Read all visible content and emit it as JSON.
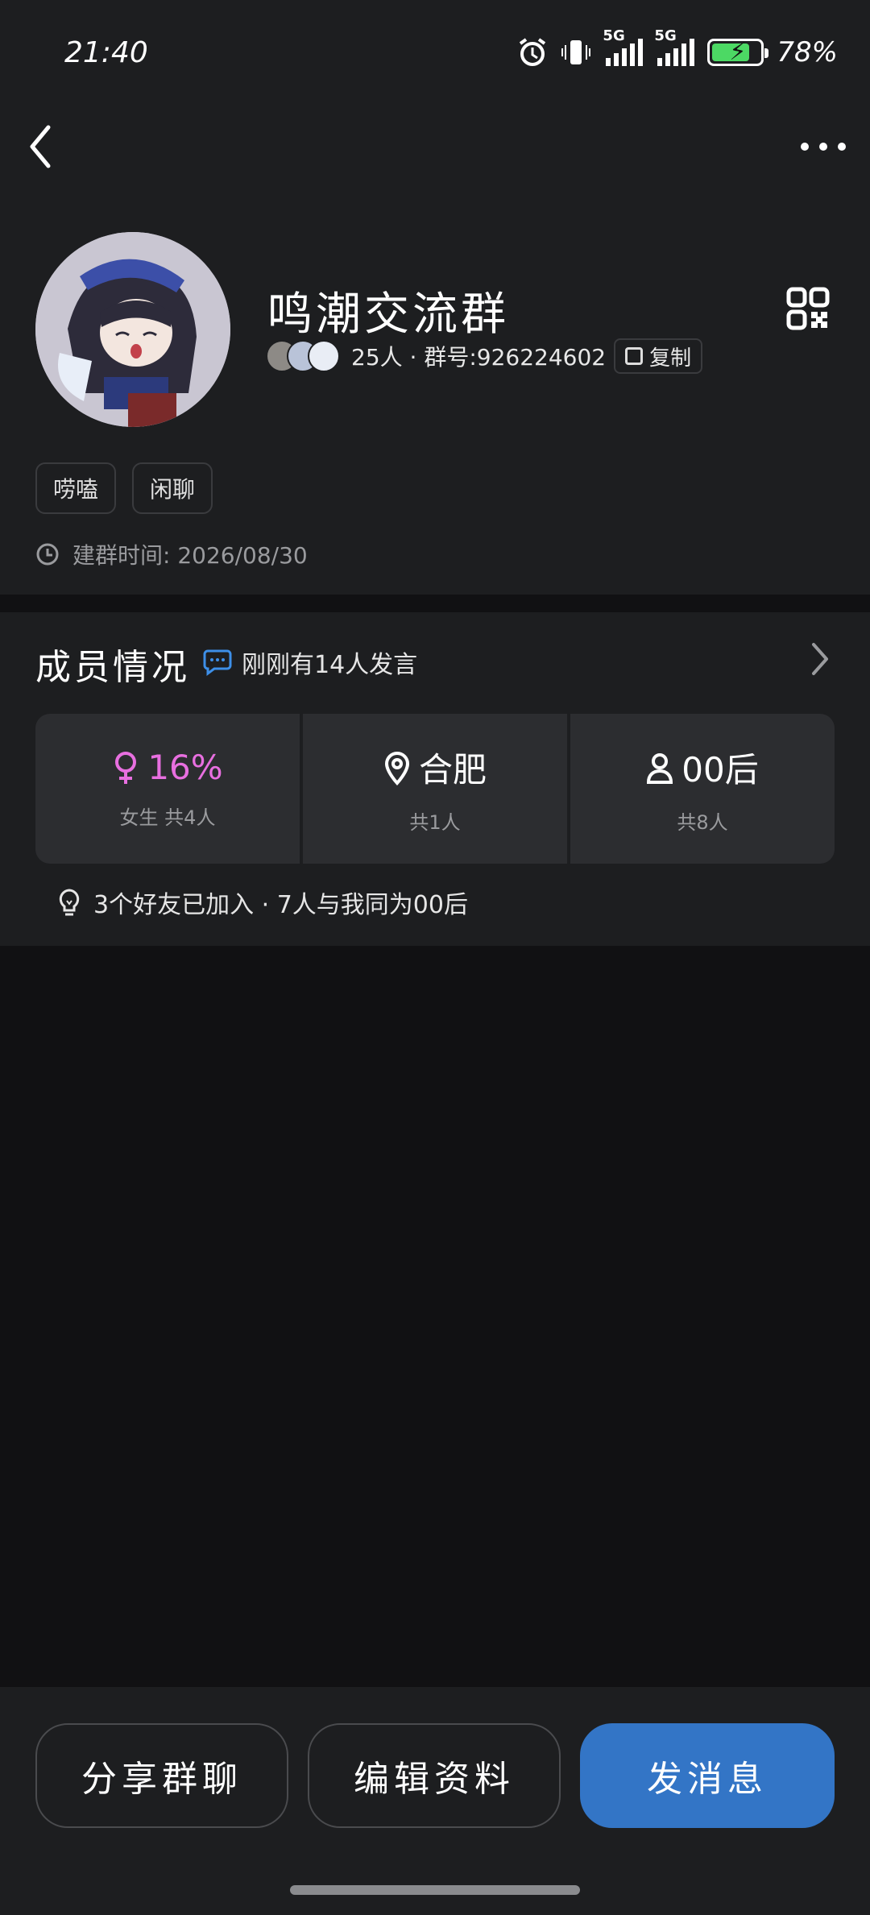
{
  "status_bar": {
    "time": "21:40",
    "signal1_label": "5G",
    "signal2_label": "5G",
    "battery_level": 0.78,
    "battery_text": "78%"
  },
  "group": {
    "name": "鸣潮交流群",
    "member_count_text": "25人 · 群号:926224602",
    "copy_label": "复制",
    "tags": [
      "唠嗑",
      "闲聊"
    ],
    "created_text": "建群时间: 2026/08/30"
  },
  "members": {
    "title": "成员情况",
    "speak_note": "刚刚有14人发言",
    "stats": [
      {
        "main": "16%",
        "sub": "女生 共4人"
      },
      {
        "main": "合肥",
        "sub": "共1人"
      },
      {
        "main": "00后",
        "sub": "共8人"
      }
    ],
    "friends_note": "3个好友已加入 · 7人与我同为00后"
  },
  "actions": {
    "share": "分享群聊",
    "edit": "编辑资料",
    "send": "发消息"
  },
  "colors": {
    "accent": "#3375c6",
    "female": "#e86fe0",
    "battery": "#4cd964"
  }
}
